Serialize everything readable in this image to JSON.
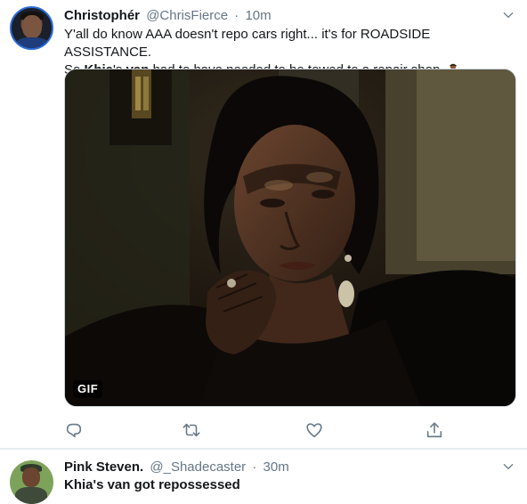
{
  "tweets": [
    {
      "display_name": "Christophér",
      "handle": "@ChrisFierce",
      "separator": "·",
      "time": "10m",
      "text_line1": "Y'all do know AAA doesn't repo cars right... it's for ROADSIDE ASSISTANCE.",
      "text_line2_parts": {
        "pre": "So ",
        "bold1": "Khia",
        "mid1": "'s ",
        "bold2": "van",
        "post": " had to have needed to be towed to a repair shop."
      },
      "emoji": "person-shrugging-emoji",
      "media_badge": "GIF",
      "actions": [
        "reply-icon",
        "retweet-icon",
        "like-icon",
        "share-icon"
      ]
    },
    {
      "display_name": "Pink Steven.",
      "handle": "@_Shadecaster",
      "separator": "·",
      "time": "30m",
      "text_partial": "Khia's van got repossessed"
    }
  ],
  "colors": {
    "text_primary": "#14171a",
    "text_secondary": "#657786",
    "border": "#e6ecf0",
    "avatar_ring": "#2b6cd8"
  }
}
